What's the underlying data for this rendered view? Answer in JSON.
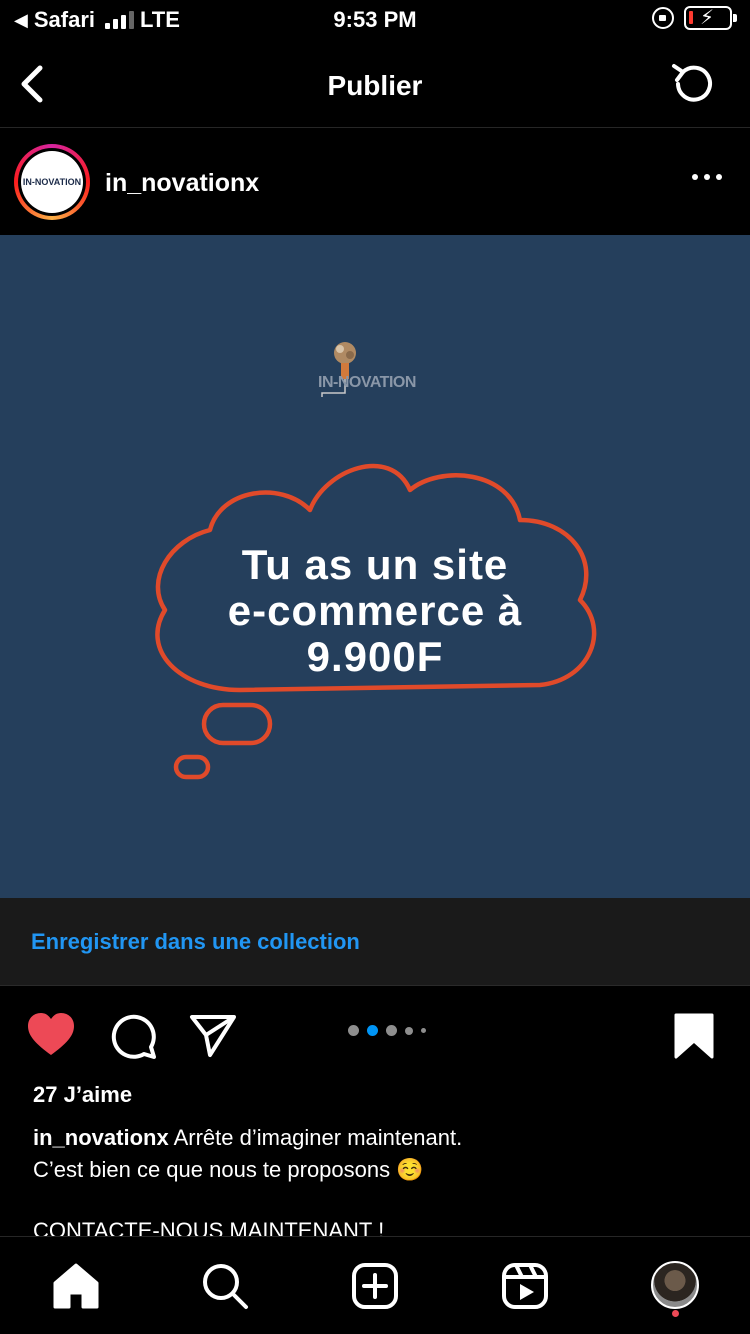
{
  "status_bar": {
    "back_app": "Safari",
    "network": "LTE",
    "time": "9:53 PM"
  },
  "header": {
    "title": "Publier",
    "back_icon": "chevron-left-icon",
    "refresh_icon": "refresh-icon"
  },
  "post": {
    "username": "in_novationx",
    "avatar_text": "IN-NOVATION",
    "image": {
      "brand": "IN-NOVATION",
      "headline_lines": [
        "Tu as un site",
        "e-commerce à",
        "9.900F"
      ],
      "background_color": "#253f5c",
      "cloud_color": "#e04a2a"
    }
  },
  "collection": {
    "label": "Enregistrer dans une collection",
    "color": "#2196f3"
  },
  "actions": {
    "liked": true,
    "heart_color": "#ed4956",
    "carousel": {
      "count": 5,
      "active_index": 1
    }
  },
  "likes": "27 J’aime",
  "caption": {
    "user": "in_novationx",
    "line1": " Arrête d’imaginer maintenant.",
    "line2": "C’est bien ce que nous te proposons ☺️",
    "line3": "CONTACTE-NOUS MAINTENANT !"
  },
  "bottom_nav": {
    "items": [
      "home-icon",
      "search-icon",
      "add-post-icon",
      "reels-icon",
      "profile-avatar"
    ],
    "profile_notification": true
  }
}
